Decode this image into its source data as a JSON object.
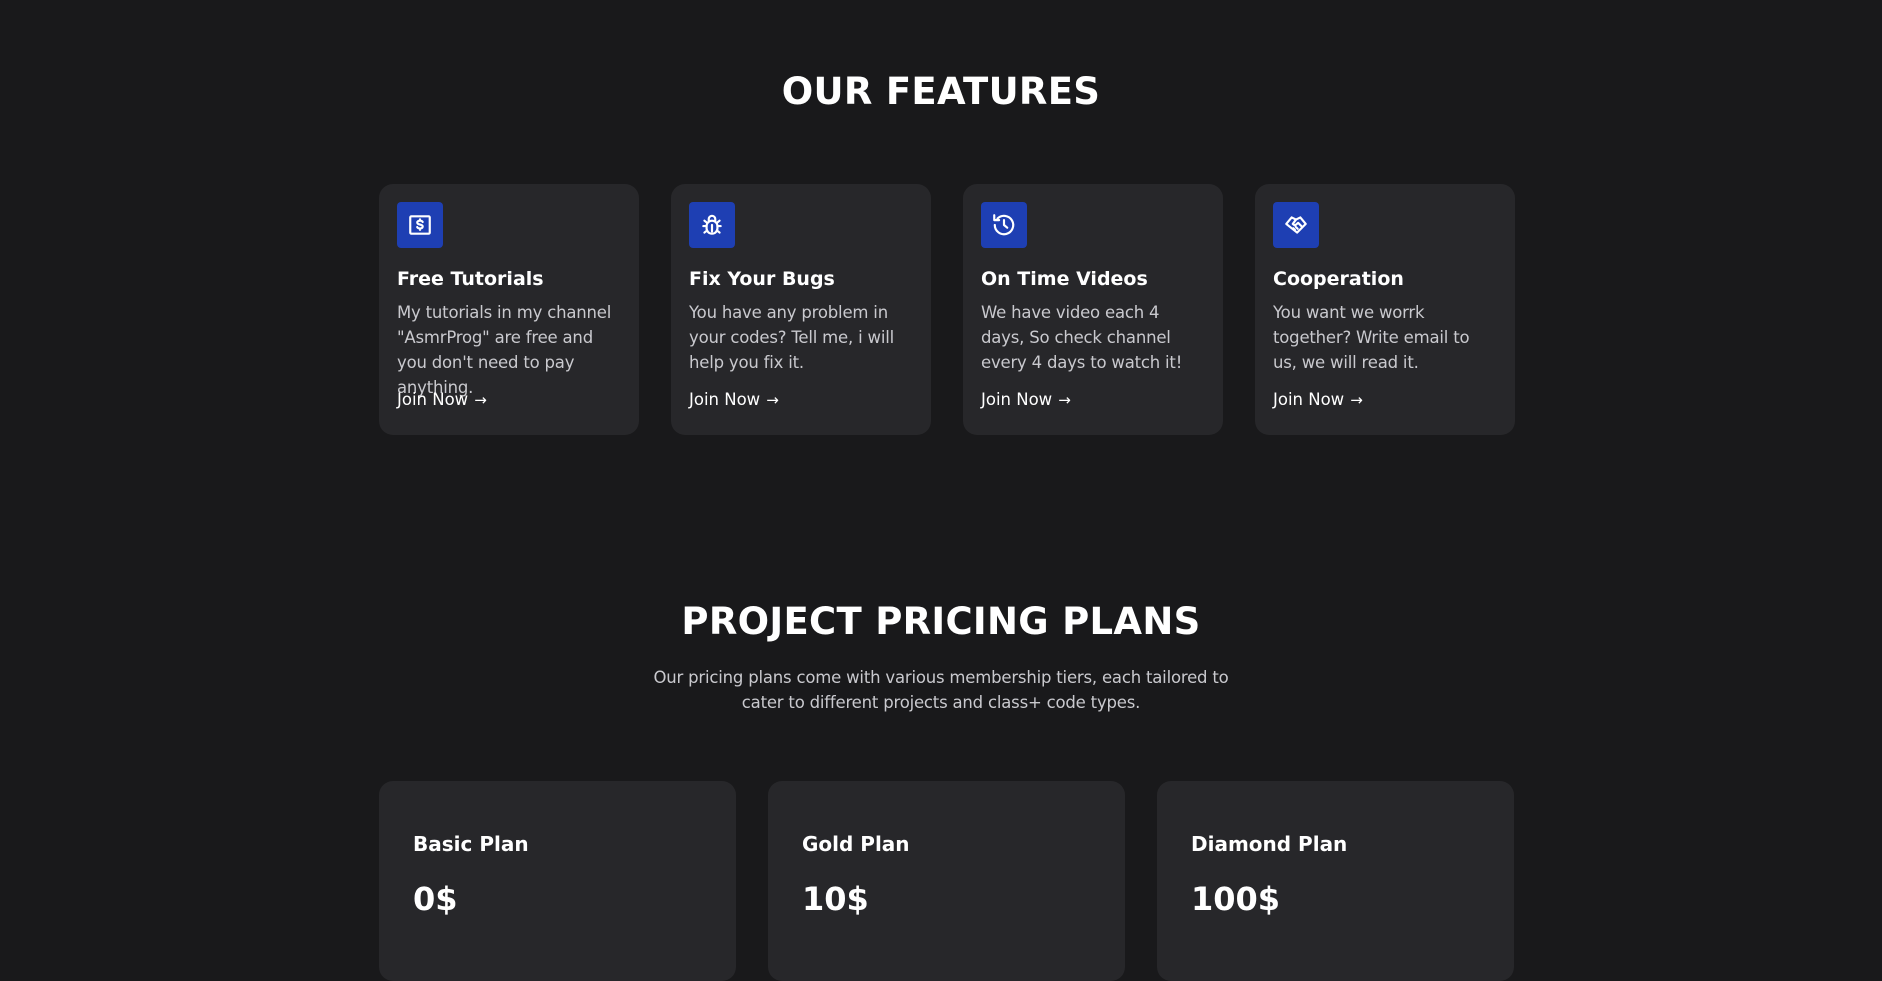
{
  "features": {
    "title": "OUR FEATURES",
    "accent_color": "#1e3fb3",
    "cards": [
      {
        "icon": "dollar-bill-icon",
        "title": "Free Tutorials",
        "description": "My tutorials in my channel \"AsmrProg\" are free and you don't need to pay anything.",
        "link_label": "Join Now"
      },
      {
        "icon": "bug-icon",
        "title": "Fix Your Bugs",
        "description": "You have any problem in your codes? Tell me, i will help you fix it.",
        "link_label": "Join Now"
      },
      {
        "icon": "history-icon",
        "title": "On Time Videos",
        "description": "We have video each 4 days, So check channel every 4 days to watch it!",
        "link_label": "Join Now"
      },
      {
        "icon": "handshake-icon",
        "title": "Cooperation",
        "description": "You want we worrk together? Write email to us, we will read it.",
        "link_label": "Join Now"
      }
    ]
  },
  "pricing": {
    "title": "PROJECT PRICING PLANS",
    "subtitle": "Our pricing plans come with various membership tiers, each tailored to cater to different projects and class+ code types.",
    "plans": [
      {
        "name": "Basic Plan",
        "price": "0$"
      },
      {
        "name": "Gold Plan",
        "price": "10$"
      },
      {
        "name": "Diamond Plan",
        "price": "100$"
      }
    ]
  },
  "colors": {
    "background": "#19191b",
    "card": "#27272a",
    "muted_text": "#c9c9ce"
  }
}
